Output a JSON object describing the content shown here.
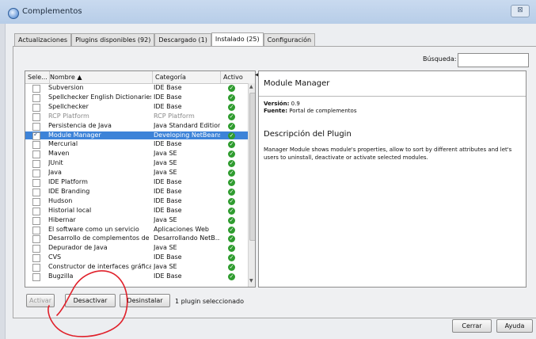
{
  "window": {
    "title": "Complementos",
    "close_symbol": "⊠"
  },
  "tabs": [
    {
      "label": "Actualizaciones",
      "active": false
    },
    {
      "label": "Plugins disponibles (92)",
      "active": false
    },
    {
      "label": "Descargado (1)",
      "active": false
    },
    {
      "label": "Instalado (25)",
      "active": true
    },
    {
      "label": "Configuración",
      "active": false
    }
  ],
  "search": {
    "label": "Búsqueda:",
    "value": ""
  },
  "table": {
    "headers": {
      "select": "Sele...",
      "name": "Nombre ▲",
      "category": "Categoría",
      "active": "Activo"
    },
    "rows": [
      {
        "checked": false,
        "name": "Subversion",
        "category": "IDE Base",
        "active": true,
        "muted": false,
        "selected": false
      },
      {
        "checked": false,
        "name": "Spellchecker English Dictionaries",
        "category": "IDE Base",
        "active": true,
        "muted": false,
        "selected": false
      },
      {
        "checked": false,
        "name": "Spellchecker",
        "category": "IDE Base",
        "active": true,
        "muted": false,
        "selected": false
      },
      {
        "checked": false,
        "name": "RCP Platform",
        "category": "RCP Platform",
        "active": true,
        "muted": true,
        "selected": false
      },
      {
        "checked": false,
        "name": "Persistencia de Java",
        "category": "Java Standard Edition",
        "active": true,
        "muted": false,
        "selected": false
      },
      {
        "checked": true,
        "name": "Module Manager",
        "category": "Developing NetBeans",
        "active": true,
        "muted": false,
        "selected": true
      },
      {
        "checked": false,
        "name": "Mercurial",
        "category": "IDE Base",
        "active": true,
        "muted": false,
        "selected": false
      },
      {
        "checked": false,
        "name": "Maven",
        "category": "Java SE",
        "active": true,
        "muted": false,
        "selected": false
      },
      {
        "checked": false,
        "name": "JUnit",
        "category": "Java SE",
        "active": true,
        "muted": false,
        "selected": false
      },
      {
        "checked": false,
        "name": "Java",
        "category": "Java SE",
        "active": true,
        "muted": false,
        "selected": false
      },
      {
        "checked": false,
        "name": "IDE Platform",
        "category": "IDE Base",
        "active": true,
        "muted": false,
        "selected": false
      },
      {
        "checked": false,
        "name": "IDE Branding",
        "category": "IDE Base",
        "active": true,
        "muted": false,
        "selected": false
      },
      {
        "checked": false,
        "name": "Hudson",
        "category": "IDE Base",
        "active": true,
        "muted": false,
        "selected": false
      },
      {
        "checked": false,
        "name": "Historial local",
        "category": "IDE Base",
        "active": true,
        "muted": false,
        "selected": false
      },
      {
        "checked": false,
        "name": "Hibernar",
        "category": "Java SE",
        "active": true,
        "muted": false,
        "selected": false
      },
      {
        "checked": false,
        "name": "El software como un servicio",
        "category": "Aplicaciones Web",
        "active": true,
        "muted": false,
        "selected": false
      },
      {
        "checked": false,
        "name": "Desarrollo de complementos de N...",
        "category": "Desarrollando NetB...",
        "active": true,
        "muted": false,
        "selected": false
      },
      {
        "checked": false,
        "name": "Depurador de Java",
        "category": "Java SE",
        "active": true,
        "muted": false,
        "selected": false
      },
      {
        "checked": false,
        "name": "CVS",
        "category": "IDE Base",
        "active": true,
        "muted": false,
        "selected": false
      },
      {
        "checked": false,
        "name": "Constructor de interfaces gráficas",
        "category": "Java SE",
        "active": true,
        "muted": false,
        "selected": false
      },
      {
        "checked": false,
        "name": "Bugzilla",
        "category": "IDE Base",
        "active": true,
        "muted": false,
        "selected": false
      }
    ]
  },
  "details": {
    "title": "Module Manager",
    "version_label": "Versión:",
    "version_value": "0.9",
    "source_label": "Fuente:",
    "source_value": "Portal de complementos",
    "description_heading": "Descripción del Plugin",
    "description": "Manager Module shows module's properties, allow to sort by different attributes and let's users to uninstall, deactivate or activate selected modules."
  },
  "actions": {
    "activate": "Activar",
    "deactivate": "Desactivar",
    "uninstall": "Desinstalar",
    "status": "1 plugin seleccionado"
  },
  "footer": {
    "close": "Cerrar",
    "help": "Ayuda"
  },
  "colors": {
    "selection": "#3d83d8",
    "active_check": "#2f9c2f",
    "annotation": "#e0202a"
  }
}
